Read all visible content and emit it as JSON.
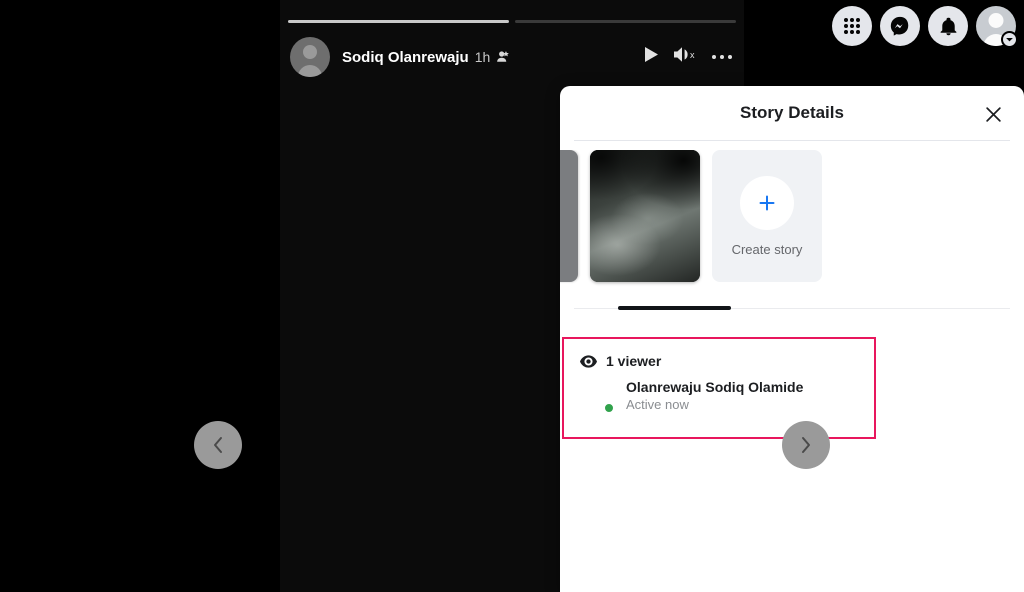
{
  "colors": {
    "page_background": "#000000",
    "accent_blue": "#1877f2",
    "annotation_pink": "#e8175d",
    "active_green": "#31a24c",
    "modal_background": "#ffffff",
    "card_background": "#f0f2f5"
  },
  "topnav": {
    "items": [
      {
        "name": "menu-grid",
        "icon": "grid-icon",
        "label": "Menu"
      },
      {
        "name": "messenger",
        "icon": "messenger-icon",
        "label": "Messenger"
      },
      {
        "name": "notifications",
        "icon": "bell-icon",
        "label": "Notifications"
      },
      {
        "name": "account",
        "icon": "avatar-icon",
        "label": "Account"
      }
    ]
  },
  "story": {
    "progress": {
      "total_segments": 2,
      "current_segment": 1,
      "segments": [
        100,
        0
      ]
    },
    "author": "Sodiq Olanrewaju",
    "time_ago": "1h",
    "audience_icon": "audience-friends-icon",
    "controls": [
      {
        "name": "play-button",
        "icon": "play-icon"
      },
      {
        "name": "mute-button",
        "icon": "speaker-muted-icon"
      },
      {
        "name": "more-options-button",
        "icon": "ellipsis-icon"
      }
    ]
  },
  "modal": {
    "title": "Story Details",
    "close_icon": "close-icon",
    "tray": {
      "cards": [
        {
          "type": "partial-story",
          "name": "story-card-previous",
          "label": ""
        },
        {
          "type": "story-thumbnail",
          "name": "story-card-active",
          "label": ""
        },
        {
          "type": "create",
          "name": "create-story-card",
          "label": "Create story",
          "icon": "plus-icon"
        }
      ]
    },
    "viewers": {
      "count_label": "1 viewer",
      "eye_icon": "eye-icon",
      "list": [
        {
          "name": "Olanrewaju Sodiq Olamide",
          "status": "Active now",
          "avatar_color": "#775a50",
          "online": true
        }
      ]
    }
  },
  "navigation": {
    "previous": {
      "label": "Previous story",
      "icon": "chevron-left-icon"
    },
    "next": {
      "label": "Next story",
      "icon": "chevron-right-icon"
    }
  }
}
